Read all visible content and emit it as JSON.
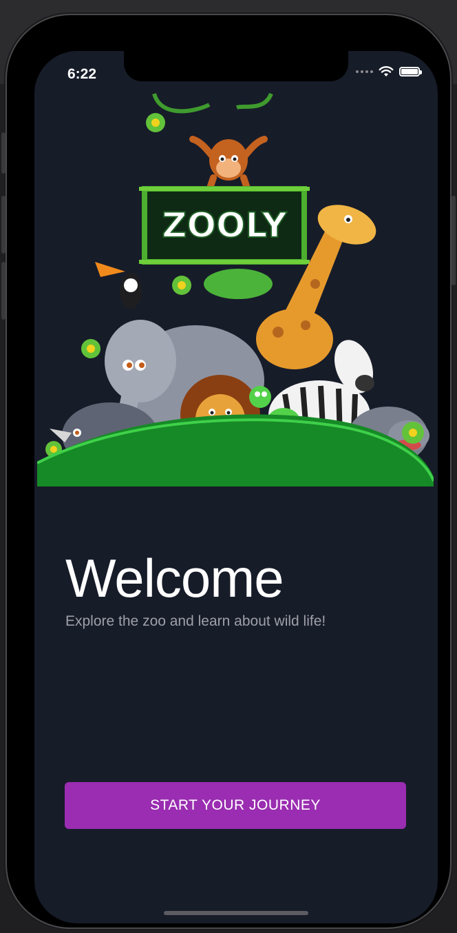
{
  "status_bar": {
    "time": "6:22"
  },
  "hero": {
    "logo_text": "ZOOLY"
  },
  "welcome": {
    "title": "Welcome",
    "subtitle": "Explore the zoo and learn about wild life!"
  },
  "cta": {
    "label": "START YOUR JOURNEY"
  },
  "colors": {
    "screen_bg": "#171c29",
    "accent": "#9a2db1",
    "grass": "#168a26"
  }
}
